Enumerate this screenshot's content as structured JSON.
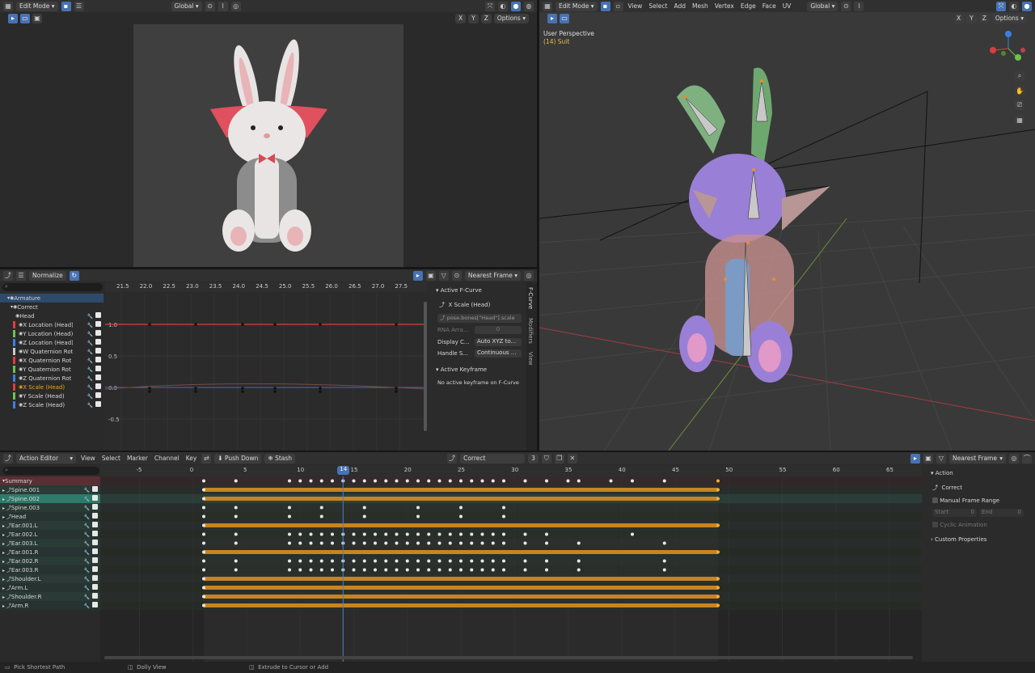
{
  "image_editor": {
    "mode": "Edit Mode",
    "orientation": "Global",
    "axes": [
      "X",
      "Y",
      "Z"
    ],
    "options": "Options"
  },
  "viewport": {
    "mode": "Edit Mode",
    "menus": [
      "View",
      "Select",
      "Add",
      "Mesh",
      "Vertex",
      "Edge",
      "Face",
      "UV"
    ],
    "orientation": "Global",
    "axes": [
      "X",
      "Y",
      "Z"
    ],
    "options": "Options",
    "perspective": "User Perspective",
    "object_info": "(14) Suit"
  },
  "graph_editor": {
    "normalize": "Normalize",
    "snap": "Nearest Frame",
    "ruler": [
      "21.5",
      "22.0",
      "22.5",
      "23.0",
      "23.5",
      "24.0",
      "24.5",
      "25.0",
      "25.5",
      "26.0",
      "26.5",
      "27.0",
      "27.5"
    ],
    "y_labels": [
      "1.0",
      "0.5",
      "0.0",
      "-0.5"
    ],
    "channels": [
      {
        "name": "Armature",
        "color": "#6fa3d9"
      },
      {
        "name": "Correct",
        "color": "#cfcfcf"
      },
      {
        "name": "Head",
        "color": "#e6e6e6"
      },
      {
        "name": "X Location (Head)",
        "color": "#e03c3c"
      },
      {
        "name": "Y Location (Head)",
        "color": "#6cc34a"
      },
      {
        "name": "Z Location (Head)",
        "color": "#3c7fe0"
      },
      {
        "name": "W Quaternion Rot",
        "color": "#c9c9c9"
      },
      {
        "name": "X Quaternion Rot",
        "color": "#e03c3c"
      },
      {
        "name": "Y Quaternion Rot",
        "color": "#6cc34a"
      },
      {
        "name": "Z Quaternion Rot",
        "color": "#3c7fe0"
      },
      {
        "name": "X Scale (Head)",
        "color": "#e03c3c"
      },
      {
        "name": "Y Scale (Head)",
        "color": "#6cc34a"
      },
      {
        "name": "Z Scale (Head)",
        "color": "#3c7fe0"
      }
    ],
    "sidebar": {
      "active_fcurve": "Active F-Curve",
      "fcurve_name": "X Scale (Head)",
      "data_path": "pose.bones[\"Head\"].scale",
      "rna_label": "RNA Arra...",
      "rna_value": "0",
      "display_label": "Display C...",
      "display_value": "Auto XYZ to...",
      "handle_label": "Handle S...",
      "handle_value": "Continuous ...",
      "active_keyframe": "Active Keyframe",
      "no_keyframe": "No active keyframe on F-Curve",
      "tabs": [
        "F-Curve",
        "Modifiers",
        "View"
      ]
    }
  },
  "action_editor": {
    "mode": "Action Editor",
    "menus": [
      "View",
      "Select",
      "Marker",
      "Channel",
      "Key"
    ],
    "push_down": "Push Down",
    "stash": "Stash",
    "action_name": "Correct",
    "users": "3",
    "snap": "Nearest Frame",
    "ruler": [
      {
        "v": "-5",
        "f": -5
      },
      {
        "v": "0",
        "f": 0
      },
      {
        "v": "5",
        "f": 5
      },
      {
        "v": "10",
        "f": 10
      },
      {
        "v": "15",
        "f": 15
      },
      {
        "v": "20",
        "f": 20
      },
      {
        "v": "25",
        "f": 25
      },
      {
        "v": "30",
        "f": 30
      },
      {
        "v": "35",
        "f": 35
      },
      {
        "v": "40",
        "f": 40
      },
      {
        "v": "45",
        "f": 45
      },
      {
        "v": "50",
        "f": 50
      },
      {
        "v": "55",
        "f": 55
      },
      {
        "v": "60",
        "f": 60
      },
      {
        "v": "65",
        "f": 65
      }
    ],
    "current_frame": "14",
    "channels": [
      {
        "name": "Summary",
        "kind": "summary"
      },
      {
        "name": "Spine.001",
        "kind": "bar"
      },
      {
        "name": "Spine.002",
        "kind": "bar",
        "selected": true
      },
      {
        "name": "Spine.003",
        "kind": "dots",
        "set": "a"
      },
      {
        "name": "Head",
        "kind": "dots",
        "set": "a"
      },
      {
        "name": "Ear.001.L",
        "kind": "bar"
      },
      {
        "name": "Ear.002.L",
        "kind": "dots",
        "set": "b"
      },
      {
        "name": "Ear.003.L",
        "kind": "dots",
        "set": "c"
      },
      {
        "name": "Ear.001.R",
        "kind": "bar"
      },
      {
        "name": "Ear.002.R",
        "kind": "dots",
        "set": "c"
      },
      {
        "name": "Ear.003.R",
        "kind": "dots",
        "set": "c"
      },
      {
        "name": "Shoulder.L",
        "kind": "bar"
      },
      {
        "name": "Arm.L",
        "kind": "bar"
      },
      {
        "name": "Shoulder.R",
        "kind": "bar"
      },
      {
        "name": "Arm.R",
        "kind": "bar"
      }
    ],
    "sidebar": {
      "action": "Action",
      "action_name": "Correct",
      "manual_range": "Manual Frame Range",
      "start_label": "Start",
      "start_value": "0",
      "end_label": "End",
      "end_value": "0",
      "cyclic": "Cyclic Animation",
      "custom_props": "Custom Properties"
    }
  },
  "status_bar": {
    "left": "Pick Shortest Path",
    "mid": "Dolly View",
    "right": "Extrude to Cursor or Add"
  }
}
